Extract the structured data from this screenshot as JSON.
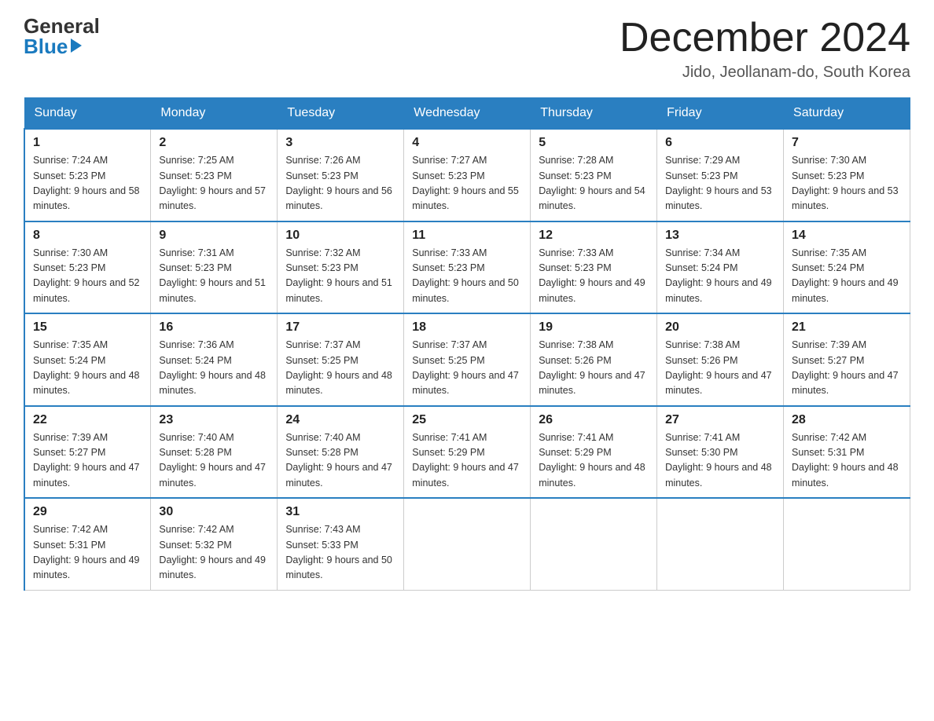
{
  "header": {
    "logo_general": "General",
    "logo_blue": "Blue",
    "month_title": "December 2024",
    "location": "Jido, Jeollanam-do, South Korea"
  },
  "days_of_week": [
    "Sunday",
    "Monday",
    "Tuesday",
    "Wednesday",
    "Thursday",
    "Friday",
    "Saturday"
  ],
  "weeks": [
    [
      {
        "day": "1",
        "sunrise": "7:24 AM",
        "sunset": "5:23 PM",
        "daylight": "9 hours and 58 minutes."
      },
      {
        "day": "2",
        "sunrise": "7:25 AM",
        "sunset": "5:23 PM",
        "daylight": "9 hours and 57 minutes."
      },
      {
        "day": "3",
        "sunrise": "7:26 AM",
        "sunset": "5:23 PM",
        "daylight": "9 hours and 56 minutes."
      },
      {
        "day": "4",
        "sunrise": "7:27 AM",
        "sunset": "5:23 PM",
        "daylight": "9 hours and 55 minutes."
      },
      {
        "day": "5",
        "sunrise": "7:28 AM",
        "sunset": "5:23 PM",
        "daylight": "9 hours and 54 minutes."
      },
      {
        "day": "6",
        "sunrise": "7:29 AM",
        "sunset": "5:23 PM",
        "daylight": "9 hours and 53 minutes."
      },
      {
        "day": "7",
        "sunrise": "7:30 AM",
        "sunset": "5:23 PM",
        "daylight": "9 hours and 53 minutes."
      }
    ],
    [
      {
        "day": "8",
        "sunrise": "7:30 AM",
        "sunset": "5:23 PM",
        "daylight": "9 hours and 52 minutes."
      },
      {
        "day": "9",
        "sunrise": "7:31 AM",
        "sunset": "5:23 PM",
        "daylight": "9 hours and 51 minutes."
      },
      {
        "day": "10",
        "sunrise": "7:32 AM",
        "sunset": "5:23 PM",
        "daylight": "9 hours and 51 minutes."
      },
      {
        "day": "11",
        "sunrise": "7:33 AM",
        "sunset": "5:23 PM",
        "daylight": "9 hours and 50 minutes."
      },
      {
        "day": "12",
        "sunrise": "7:33 AM",
        "sunset": "5:23 PM",
        "daylight": "9 hours and 49 minutes."
      },
      {
        "day": "13",
        "sunrise": "7:34 AM",
        "sunset": "5:24 PM",
        "daylight": "9 hours and 49 minutes."
      },
      {
        "day": "14",
        "sunrise": "7:35 AM",
        "sunset": "5:24 PM",
        "daylight": "9 hours and 49 minutes."
      }
    ],
    [
      {
        "day": "15",
        "sunrise": "7:35 AM",
        "sunset": "5:24 PM",
        "daylight": "9 hours and 48 minutes."
      },
      {
        "day": "16",
        "sunrise": "7:36 AM",
        "sunset": "5:24 PM",
        "daylight": "9 hours and 48 minutes."
      },
      {
        "day": "17",
        "sunrise": "7:37 AM",
        "sunset": "5:25 PM",
        "daylight": "9 hours and 48 minutes."
      },
      {
        "day": "18",
        "sunrise": "7:37 AM",
        "sunset": "5:25 PM",
        "daylight": "9 hours and 47 minutes."
      },
      {
        "day": "19",
        "sunrise": "7:38 AM",
        "sunset": "5:26 PM",
        "daylight": "9 hours and 47 minutes."
      },
      {
        "day": "20",
        "sunrise": "7:38 AM",
        "sunset": "5:26 PM",
        "daylight": "9 hours and 47 minutes."
      },
      {
        "day": "21",
        "sunrise": "7:39 AM",
        "sunset": "5:27 PM",
        "daylight": "9 hours and 47 minutes."
      }
    ],
    [
      {
        "day": "22",
        "sunrise": "7:39 AM",
        "sunset": "5:27 PM",
        "daylight": "9 hours and 47 minutes."
      },
      {
        "day": "23",
        "sunrise": "7:40 AM",
        "sunset": "5:28 PM",
        "daylight": "9 hours and 47 minutes."
      },
      {
        "day": "24",
        "sunrise": "7:40 AM",
        "sunset": "5:28 PM",
        "daylight": "9 hours and 47 minutes."
      },
      {
        "day": "25",
        "sunrise": "7:41 AM",
        "sunset": "5:29 PM",
        "daylight": "9 hours and 47 minutes."
      },
      {
        "day": "26",
        "sunrise": "7:41 AM",
        "sunset": "5:29 PM",
        "daylight": "9 hours and 48 minutes."
      },
      {
        "day": "27",
        "sunrise": "7:41 AM",
        "sunset": "5:30 PM",
        "daylight": "9 hours and 48 minutes."
      },
      {
        "day": "28",
        "sunrise": "7:42 AM",
        "sunset": "5:31 PM",
        "daylight": "9 hours and 48 minutes."
      }
    ],
    [
      {
        "day": "29",
        "sunrise": "7:42 AM",
        "sunset": "5:31 PM",
        "daylight": "9 hours and 49 minutes."
      },
      {
        "day": "30",
        "sunrise": "7:42 AM",
        "sunset": "5:32 PM",
        "daylight": "9 hours and 49 minutes."
      },
      {
        "day": "31",
        "sunrise": "7:43 AM",
        "sunset": "5:33 PM",
        "daylight": "9 hours and 50 minutes."
      },
      null,
      null,
      null,
      null
    ]
  ]
}
